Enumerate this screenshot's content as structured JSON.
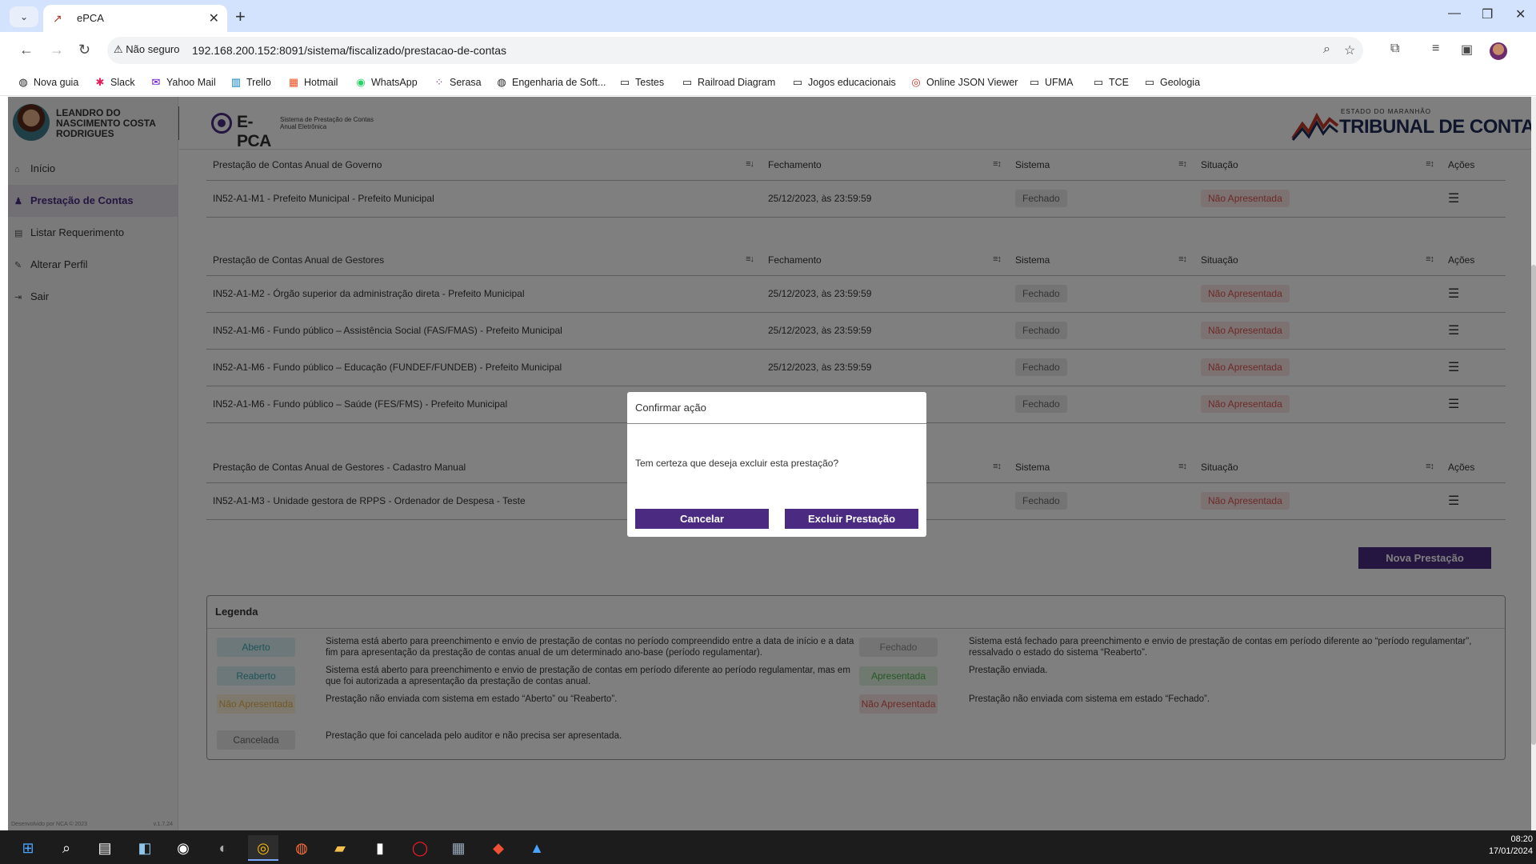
{
  "browser": {
    "tab_title": "ePCA",
    "security_label": "Não seguro",
    "url": "192.168.200.152:8091/sistema/fiscalizado/prestacao-de-contas",
    "bookmarks": [
      "Nova guia",
      "Slack",
      "Yahoo Mail",
      "Trello",
      "Hotmail",
      "WhatsApp",
      "Serasa",
      "Engenharia de Soft...",
      "Testes",
      "Railroad Diagram",
      "Jogos educacionais",
      "Online JSON Viewer",
      "UFMA",
      "TCE",
      "Geologia"
    ]
  },
  "sidebar": {
    "user_name": "LEANDRO DO NASCIMENTO COSTA RODRIGUES",
    "items": [
      {
        "label": "Início",
        "icon": "home-icon"
      },
      {
        "label": "Prestação de Contas",
        "icon": "user-icon",
        "active": true
      },
      {
        "label": "Listar Requerimento",
        "icon": "document-icon"
      },
      {
        "label": "Alterar Perfil",
        "icon": "user-edit-icon"
      },
      {
        "label": "Sair",
        "icon": "logout-icon"
      }
    ],
    "footer_left": "Desenvolvido por NCA © 2023",
    "footer_right": "v.1.7.24"
  },
  "header": {
    "epca_name": "E-PCA",
    "epca_subtitle": "Sistema de Prestação de Contas Anual Eletrônica",
    "tce_small": "ESTADO DO MARANHÃO",
    "tce_big": "TRIBUNAL DE CONTAS"
  },
  "tables": {
    "governo": {
      "title": "Prestação de Contas Anual de Governo",
      "headers": {
        "fechamento": "Fechamento",
        "sistema": "Sistema",
        "situacao": "Situação",
        "acoes": "Ações"
      },
      "rows": [
        {
          "name": "IN52-A1-M1 - Prefeito Municipal - Prefeito Municipal",
          "fechamento": "25/12/2023, às 23:59:59",
          "sistema": "Fechado",
          "situacao": "Não Apresentada"
        }
      ]
    },
    "gestores": {
      "title": "Prestação de Contas Anual de Gestores",
      "headers": {
        "fechamento": "Fechamento",
        "sistema": "Sistema",
        "situacao": "Situação",
        "acoes": "Ações"
      },
      "rows": [
        {
          "name": "IN52-A1-M2 - Órgão superior da administração direta - Prefeito Municipal",
          "fechamento": "25/12/2023, às 23:59:59",
          "sistema": "Fechado",
          "situacao": "Não Apresentada"
        },
        {
          "name": "IN52-A1-M6 - Fundo público – Assistência Social (FAS/FMAS) - Prefeito Municipal",
          "fechamento": "25/12/2023, às 23:59:59",
          "sistema": "Fechado",
          "situacao": "Não Apresentada"
        },
        {
          "name": "IN52-A1-M6 - Fundo público – Educação (FUNDEF/FUNDEB) - Prefeito Municipal",
          "fechamento": "25/12/2023, às 23:59:59",
          "sistema": "Fechado",
          "situacao": "Não Apresentada"
        },
        {
          "name": "IN52-A1-M6 - Fundo público – Saúde (FES/FMS) - Prefeito Municipal",
          "fechamento": "",
          "sistema": "Fechado",
          "situacao": "Não Apresentada"
        }
      ]
    },
    "manual": {
      "title": "Prestação de Contas Anual de Gestores - Cadastro Manual",
      "headers": {
        "fechamento": "",
        "sistema": "Sistema",
        "situacao": "Situação",
        "acoes": "Ações"
      },
      "rows": [
        {
          "name": "IN52-A1-M3 - Unidade gestora de RPPS - Ordenador de Despesa - Teste",
          "fechamento": "",
          "sistema": "Fechado",
          "situacao": "Não Apresentada"
        }
      ]
    }
  },
  "nova_prestacao_label": "Nova Prestação",
  "legend": {
    "title": "Legenda",
    "left": [
      {
        "badge": "Aberto",
        "text": "Sistema está aberto para preenchimento e envio de prestação de contas no período compreendido entre a data de início e a data fim para apresentação da prestação de contas anual de um determinado ano-base (período regulamentar)."
      },
      {
        "badge": "Reaberto",
        "text": "Sistema está aberto para preenchimento e envio de prestação de contas em período diferente ao período regulamentar, mas em que foi autorizada a apresentação da prestação de contas anual."
      },
      {
        "badge": "Não Apresentada",
        "text": "Prestação não enviada com sistema em estado “Aberto” ou “Reaberto”."
      },
      {
        "badge": "Cancelada",
        "text": "Prestação que foi cancelada pelo auditor e não precisa ser apresentada."
      }
    ],
    "right": [
      {
        "badge": "Fechado",
        "text": "Sistema está fechado para preenchimento e envio de prestação de contas em período diferente ao “período regulamentar”, ressalvado o estado do sistema “Reaberto”."
      },
      {
        "badge": "Apresentada",
        "text": "Prestação enviada."
      },
      {
        "badge": "Não Apresentada",
        "text": "Prestação não enviada com sistema em estado “Fechado”."
      }
    ]
  },
  "modal": {
    "title": "Confirmar ação",
    "message": "Tem certeza que deseja excluir esta prestação?",
    "cancel_label": "Cancelar",
    "confirm_label": "Excluir Prestação"
  },
  "taskbar": {
    "time": "08:20",
    "date": "17/01/2024"
  },
  "colors": {
    "primary": "#4b2a82",
    "danger_text": "#d9534f",
    "info_text": "#3ba6b1"
  }
}
